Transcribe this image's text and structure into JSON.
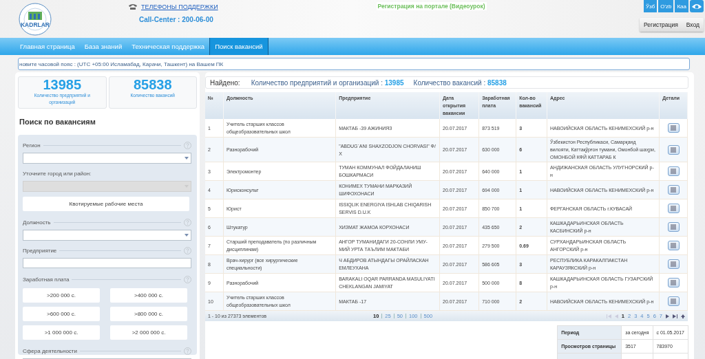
{
  "header": {
    "logo_text": "KADRLAR",
    "support_link": "ТЕЛЕФОНЫ ПОДДЕРЖКИ",
    "call_center": "Call-Center : 200-06-00",
    "video_link": "Регистрация на портале (Видеоурок)",
    "languages": [
      {
        "label": "Ўзб",
        "selected": false
      },
      {
        "label": "O'zb",
        "selected": false
      },
      {
        "label": "Каа",
        "selected": false
      }
    ],
    "auth_buttons": [
      "Регистрация",
      "Вход"
    ]
  },
  "nav": [
    {
      "label": "Главная страница",
      "selected": false
    },
    {
      "label": "База знаний",
      "selected": false
    },
    {
      "label": "Техническая поддержка",
      "selected": false
    },
    {
      "label": "Поиск вакансий",
      "selected": true
    }
  ],
  "timezone_notice": "новите часовой пояс : (UTC +05:00 Исламабад, Карачи, Ташкент) на Вашем ПК",
  "stats": [
    {
      "value": "13985",
      "label": "Количество предприятий и организаций"
    },
    {
      "value": "85838",
      "label": "Количество вакансий"
    }
  ],
  "search": {
    "title": "Поиск по вакансиям",
    "fields": [
      {
        "kind": "select",
        "label": "Регион",
        "help": true,
        "disabled": false
      },
      {
        "kind": "select",
        "label": "Уточните город или район:",
        "help": false,
        "disabled": true
      },
      {
        "kind": "button",
        "label": "Квотируемые рабочие места"
      },
      {
        "kind": "select",
        "label": "Должность",
        "help": true,
        "disabled": false
      },
      {
        "kind": "text",
        "label": "Предприятие",
        "help": true
      },
      {
        "kind": "buttons",
        "label": "Заработная плата",
        "help": true,
        "options": [
          ">200 000 с.",
          ">400 000 с.",
          ">600 000 с.",
          ">800 000 с.",
          ">1 000 000 с.",
          ">2 000 000 с."
        ]
      },
      {
        "kind": "select",
        "label": "Сфера деятельности",
        "help": true
      }
    ]
  },
  "summary": {
    "found": "Найдено:",
    "companies_label": "Количество предприятий и организаций : ",
    "companies": "13985",
    "vacancies_label": "Количество вакансий : ",
    "vacancies": "85838"
  },
  "table": {
    "columns": [
      "№",
      "Должность",
      "Предприятие",
      "Дата открытия вакансии",
      "Заработная плата",
      "Кол-во вакансий",
      "Адрес",
      "Детали"
    ],
    "rows": [
      [
        "1",
        "Учитель старших классов общеобразовательных школ",
        "МАКТАБ -39 АЖИНИЯЗ",
        "20.07.2017",
        "873 519",
        "3",
        "НАВОИЙСКАЯ ОБЛАСТЬ КЕНИМЕХСКИЙ р-н"
      ],
      [
        "2",
        "Разнорабочий",
        "\"ABDUG`ANI SHAXZODJON CHORVASI\" Ф/Х",
        "20.07.2017",
        "630 000",
        "6",
        "Ўзбекистон Республикаси, Самарқанд вилояти, Каттақўрғон тумани, Омонбой шаҳри, ОМОНБОЙ КФЙ КАТТАРАБ К"
      ],
      [
        "3",
        "Электромонтер",
        "ТУМАН КОММУНАЛ ФОЙДАЛАНИШ БОШКАРМАСИ",
        "20.07.2017",
        "640 000",
        "1",
        "АНДИЖАНСКАЯ ОБЛАСТЬ УЛУГНОРСКИЙ р-н"
      ],
      [
        "4",
        "Юрисконсульт",
        "КОНИМЕХ ТУМАНИ МАРКАЗИЙ ШИФОХОНАСИ",
        "20.07.2017",
        "694 000",
        "1",
        "НАВОИЙСКАЯ ОБЛАСТЬ КЕНИМЕХСКИЙ р-н"
      ],
      [
        "5",
        "Юрист",
        "ISSIQLIK ENERGIYA ISHLAB CHIQARISH SERVIS D.U.K",
        "20.07.2017",
        "850 700",
        "1",
        "ФЕРГАНСКАЯ ОБЛАСТЬ г.КУВАСАЙ"
      ],
      [
        "6",
        "Штукатур",
        "ХИЗМАТ ЖАМОА КОРХОНАСИ",
        "20.07.2017",
        "435 650",
        "2",
        "КАШКАДАРЬИНСКАЯ ОБЛАСТЬ КАСБИНСКИЙ р-н"
      ],
      [
        "7",
        "Старший преподаватель (по различным дисциплинам)",
        "АНГОР ТУМАНИДАГИ 20-СОНЛИ УМУ-МИЙ УРТА ТАЪЛИМ МАКТАБИ",
        "20.07.2017",
        "279 500",
        "0.69",
        "СУРХАНДАРЬИНСКАЯ ОБЛАСТЬ АНГОРСКИЙ р-н"
      ],
      [
        "8",
        "Врач-хирург (все хирургические специальности)",
        "Ч АБДИРОВ АТЫНДАГЫ ОРАЙЛАСКАН ЕМЛЕУХАНА",
        "20.07.2017",
        "586 605",
        "3",
        "РЕСПУБЛИКА КАРАКАЛПАКСТАН КАРАУЗЯКСКИЙ р-н"
      ],
      [
        "9",
        "Разнорабочий",
        "BARAKALI OQAR PARRANDA MASULIYATI CHEKLANGAN JAMIYAT",
        "20.07.2017",
        "500 000",
        "8",
        "КАШКАДАРЬИНСКАЯ ОБЛАСТЬ ГУЗАРСКИЙ р-н"
      ],
      [
        "10",
        "Учитель старших классов общеобразовательных школ",
        "МАКТАБ -17",
        "20.07.2017",
        "710 000",
        "2",
        "НАВОИЙСКАЯ ОБЛАСТЬ КЕНИМЕХСКИЙ р-н"
      ]
    ]
  },
  "pager": {
    "info": "1 - 10 из 27373 элементов",
    "page_sizes": [
      {
        "label": "10",
        "selected": true
      },
      {
        "label": "25",
        "selected": false
      },
      {
        "label": "50",
        "selected": false
      },
      {
        "label": "100",
        "selected": false
      },
      {
        "label": "500",
        "selected": false
      }
    ],
    "pages": [
      {
        "label": "1",
        "selected": true
      },
      {
        "label": "2",
        "selected": false
      },
      {
        "label": "3",
        "selected": false
      },
      {
        "label": "4",
        "selected": false
      },
      {
        "label": "5",
        "selected": false
      },
      {
        "label": "6",
        "selected": false
      },
      {
        "label": "7",
        "selected": false
      }
    ]
  },
  "visits": {
    "rows": [
      [
        "Период",
        "за сегодня",
        "с 01.05.2017"
      ],
      [
        "Просмотров страницы",
        "3517",
        "783970"
      ]
    ]
  }
}
